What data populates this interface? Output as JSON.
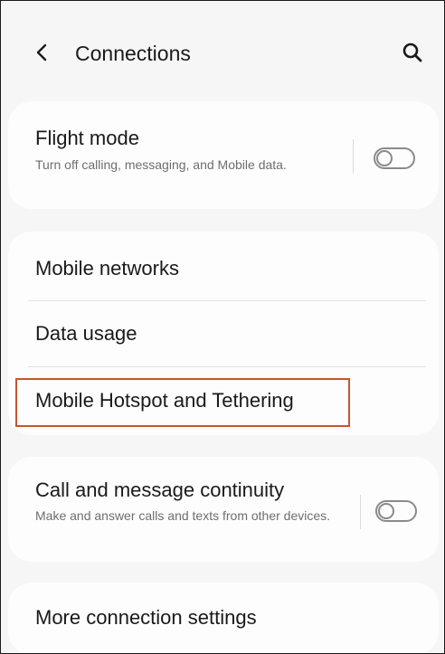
{
  "header": {
    "title": "Connections",
    "back_icon": "chevron-left-icon",
    "search_icon": "search-icon"
  },
  "flight_mode": {
    "title": "Flight mode",
    "subtitle": "Turn off calling, messaging, and Mobile data.",
    "enabled": false
  },
  "network_group": {
    "items": [
      {
        "label": "Mobile networks"
      },
      {
        "label": "Data usage"
      },
      {
        "label": "Mobile Hotspot and Tethering",
        "highlighted": true
      }
    ]
  },
  "continuity": {
    "title": "Call and message continuity",
    "subtitle": "Make and answer calls and texts from other devices.",
    "enabled": false
  },
  "more": {
    "label": "More connection settings"
  },
  "colors": {
    "background": "#f6f6f6",
    "card": "#fdfdfd",
    "highlight": "#c8552e",
    "switch_off": "#8a8a8a"
  }
}
